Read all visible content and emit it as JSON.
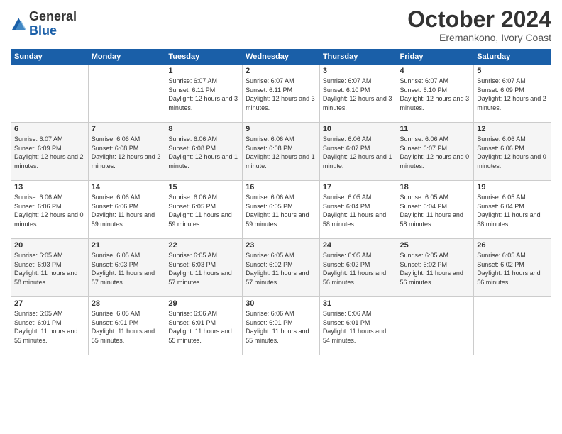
{
  "header": {
    "logo_general": "General",
    "logo_blue": "Blue",
    "month": "October 2024",
    "location": "Eremankono, Ivory Coast"
  },
  "days_of_week": [
    "Sunday",
    "Monday",
    "Tuesday",
    "Wednesday",
    "Thursday",
    "Friday",
    "Saturday"
  ],
  "weeks": [
    [
      {
        "day": "",
        "info": ""
      },
      {
        "day": "",
        "info": ""
      },
      {
        "day": "1",
        "info": "Sunrise: 6:07 AM\nSunset: 6:11 PM\nDaylight: 12 hours and 3 minutes."
      },
      {
        "day": "2",
        "info": "Sunrise: 6:07 AM\nSunset: 6:11 PM\nDaylight: 12 hours and 3 minutes."
      },
      {
        "day": "3",
        "info": "Sunrise: 6:07 AM\nSunset: 6:10 PM\nDaylight: 12 hours and 3 minutes."
      },
      {
        "day": "4",
        "info": "Sunrise: 6:07 AM\nSunset: 6:10 PM\nDaylight: 12 hours and 3 minutes."
      },
      {
        "day": "5",
        "info": "Sunrise: 6:07 AM\nSunset: 6:09 PM\nDaylight: 12 hours and 2 minutes."
      }
    ],
    [
      {
        "day": "6",
        "info": "Sunrise: 6:07 AM\nSunset: 6:09 PM\nDaylight: 12 hours and 2 minutes."
      },
      {
        "day": "7",
        "info": "Sunrise: 6:06 AM\nSunset: 6:08 PM\nDaylight: 12 hours and 2 minutes."
      },
      {
        "day": "8",
        "info": "Sunrise: 6:06 AM\nSunset: 6:08 PM\nDaylight: 12 hours and 1 minute."
      },
      {
        "day": "9",
        "info": "Sunrise: 6:06 AM\nSunset: 6:08 PM\nDaylight: 12 hours and 1 minute."
      },
      {
        "day": "10",
        "info": "Sunrise: 6:06 AM\nSunset: 6:07 PM\nDaylight: 12 hours and 1 minute."
      },
      {
        "day": "11",
        "info": "Sunrise: 6:06 AM\nSunset: 6:07 PM\nDaylight: 12 hours and 0 minutes."
      },
      {
        "day": "12",
        "info": "Sunrise: 6:06 AM\nSunset: 6:06 PM\nDaylight: 12 hours and 0 minutes."
      }
    ],
    [
      {
        "day": "13",
        "info": "Sunrise: 6:06 AM\nSunset: 6:06 PM\nDaylight: 12 hours and 0 minutes."
      },
      {
        "day": "14",
        "info": "Sunrise: 6:06 AM\nSunset: 6:06 PM\nDaylight: 11 hours and 59 minutes."
      },
      {
        "day": "15",
        "info": "Sunrise: 6:06 AM\nSunset: 6:05 PM\nDaylight: 11 hours and 59 minutes."
      },
      {
        "day": "16",
        "info": "Sunrise: 6:06 AM\nSunset: 6:05 PM\nDaylight: 11 hours and 59 minutes."
      },
      {
        "day": "17",
        "info": "Sunrise: 6:05 AM\nSunset: 6:04 PM\nDaylight: 11 hours and 58 minutes."
      },
      {
        "day": "18",
        "info": "Sunrise: 6:05 AM\nSunset: 6:04 PM\nDaylight: 11 hours and 58 minutes."
      },
      {
        "day": "19",
        "info": "Sunrise: 6:05 AM\nSunset: 6:04 PM\nDaylight: 11 hours and 58 minutes."
      }
    ],
    [
      {
        "day": "20",
        "info": "Sunrise: 6:05 AM\nSunset: 6:03 PM\nDaylight: 11 hours and 58 minutes."
      },
      {
        "day": "21",
        "info": "Sunrise: 6:05 AM\nSunset: 6:03 PM\nDaylight: 11 hours and 57 minutes."
      },
      {
        "day": "22",
        "info": "Sunrise: 6:05 AM\nSunset: 6:03 PM\nDaylight: 11 hours and 57 minutes."
      },
      {
        "day": "23",
        "info": "Sunrise: 6:05 AM\nSunset: 6:02 PM\nDaylight: 11 hours and 57 minutes."
      },
      {
        "day": "24",
        "info": "Sunrise: 6:05 AM\nSunset: 6:02 PM\nDaylight: 11 hours and 56 minutes."
      },
      {
        "day": "25",
        "info": "Sunrise: 6:05 AM\nSunset: 6:02 PM\nDaylight: 11 hours and 56 minutes."
      },
      {
        "day": "26",
        "info": "Sunrise: 6:05 AM\nSunset: 6:02 PM\nDaylight: 11 hours and 56 minutes."
      }
    ],
    [
      {
        "day": "27",
        "info": "Sunrise: 6:05 AM\nSunset: 6:01 PM\nDaylight: 11 hours and 55 minutes."
      },
      {
        "day": "28",
        "info": "Sunrise: 6:05 AM\nSunset: 6:01 PM\nDaylight: 11 hours and 55 minutes."
      },
      {
        "day": "29",
        "info": "Sunrise: 6:06 AM\nSunset: 6:01 PM\nDaylight: 11 hours and 55 minutes."
      },
      {
        "day": "30",
        "info": "Sunrise: 6:06 AM\nSunset: 6:01 PM\nDaylight: 11 hours and 55 minutes."
      },
      {
        "day": "31",
        "info": "Sunrise: 6:06 AM\nSunset: 6:01 PM\nDaylight: 11 hours and 54 minutes."
      },
      {
        "day": "",
        "info": ""
      },
      {
        "day": "",
        "info": ""
      }
    ]
  ]
}
